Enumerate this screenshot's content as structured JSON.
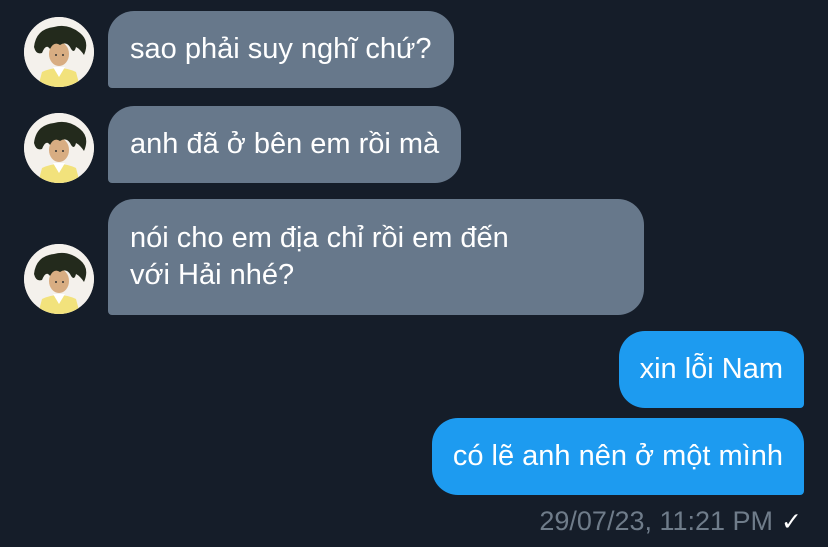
{
  "messages": [
    {
      "direction": "incoming",
      "text": "sao phải suy nghĩ chứ?"
    },
    {
      "direction": "incoming",
      "text": "anh đã ở bên em rồi mà"
    },
    {
      "direction": "incoming",
      "lines": [
        "nói cho em địa chỉ rồi em đến",
        "với Hải nhé?"
      ]
    },
    {
      "direction": "outgoing",
      "text": "xin lỗi Nam"
    },
    {
      "direction": "outgoing",
      "text": "có lẽ anh nên ở một mình"
    }
  ],
  "status": {
    "timestamp": "29/07/23, 11:21 PM",
    "read_receipt_icon": "checkmark-icon",
    "read_receipt_glyph": "✓"
  },
  "avatar": {
    "icon": "contact-avatar-icon"
  },
  "colors": {
    "background": "#151d29",
    "incoming_bubble": "#67788b",
    "outgoing_bubble": "#1d9bf0",
    "timestamp": "#6f7c8a"
  }
}
